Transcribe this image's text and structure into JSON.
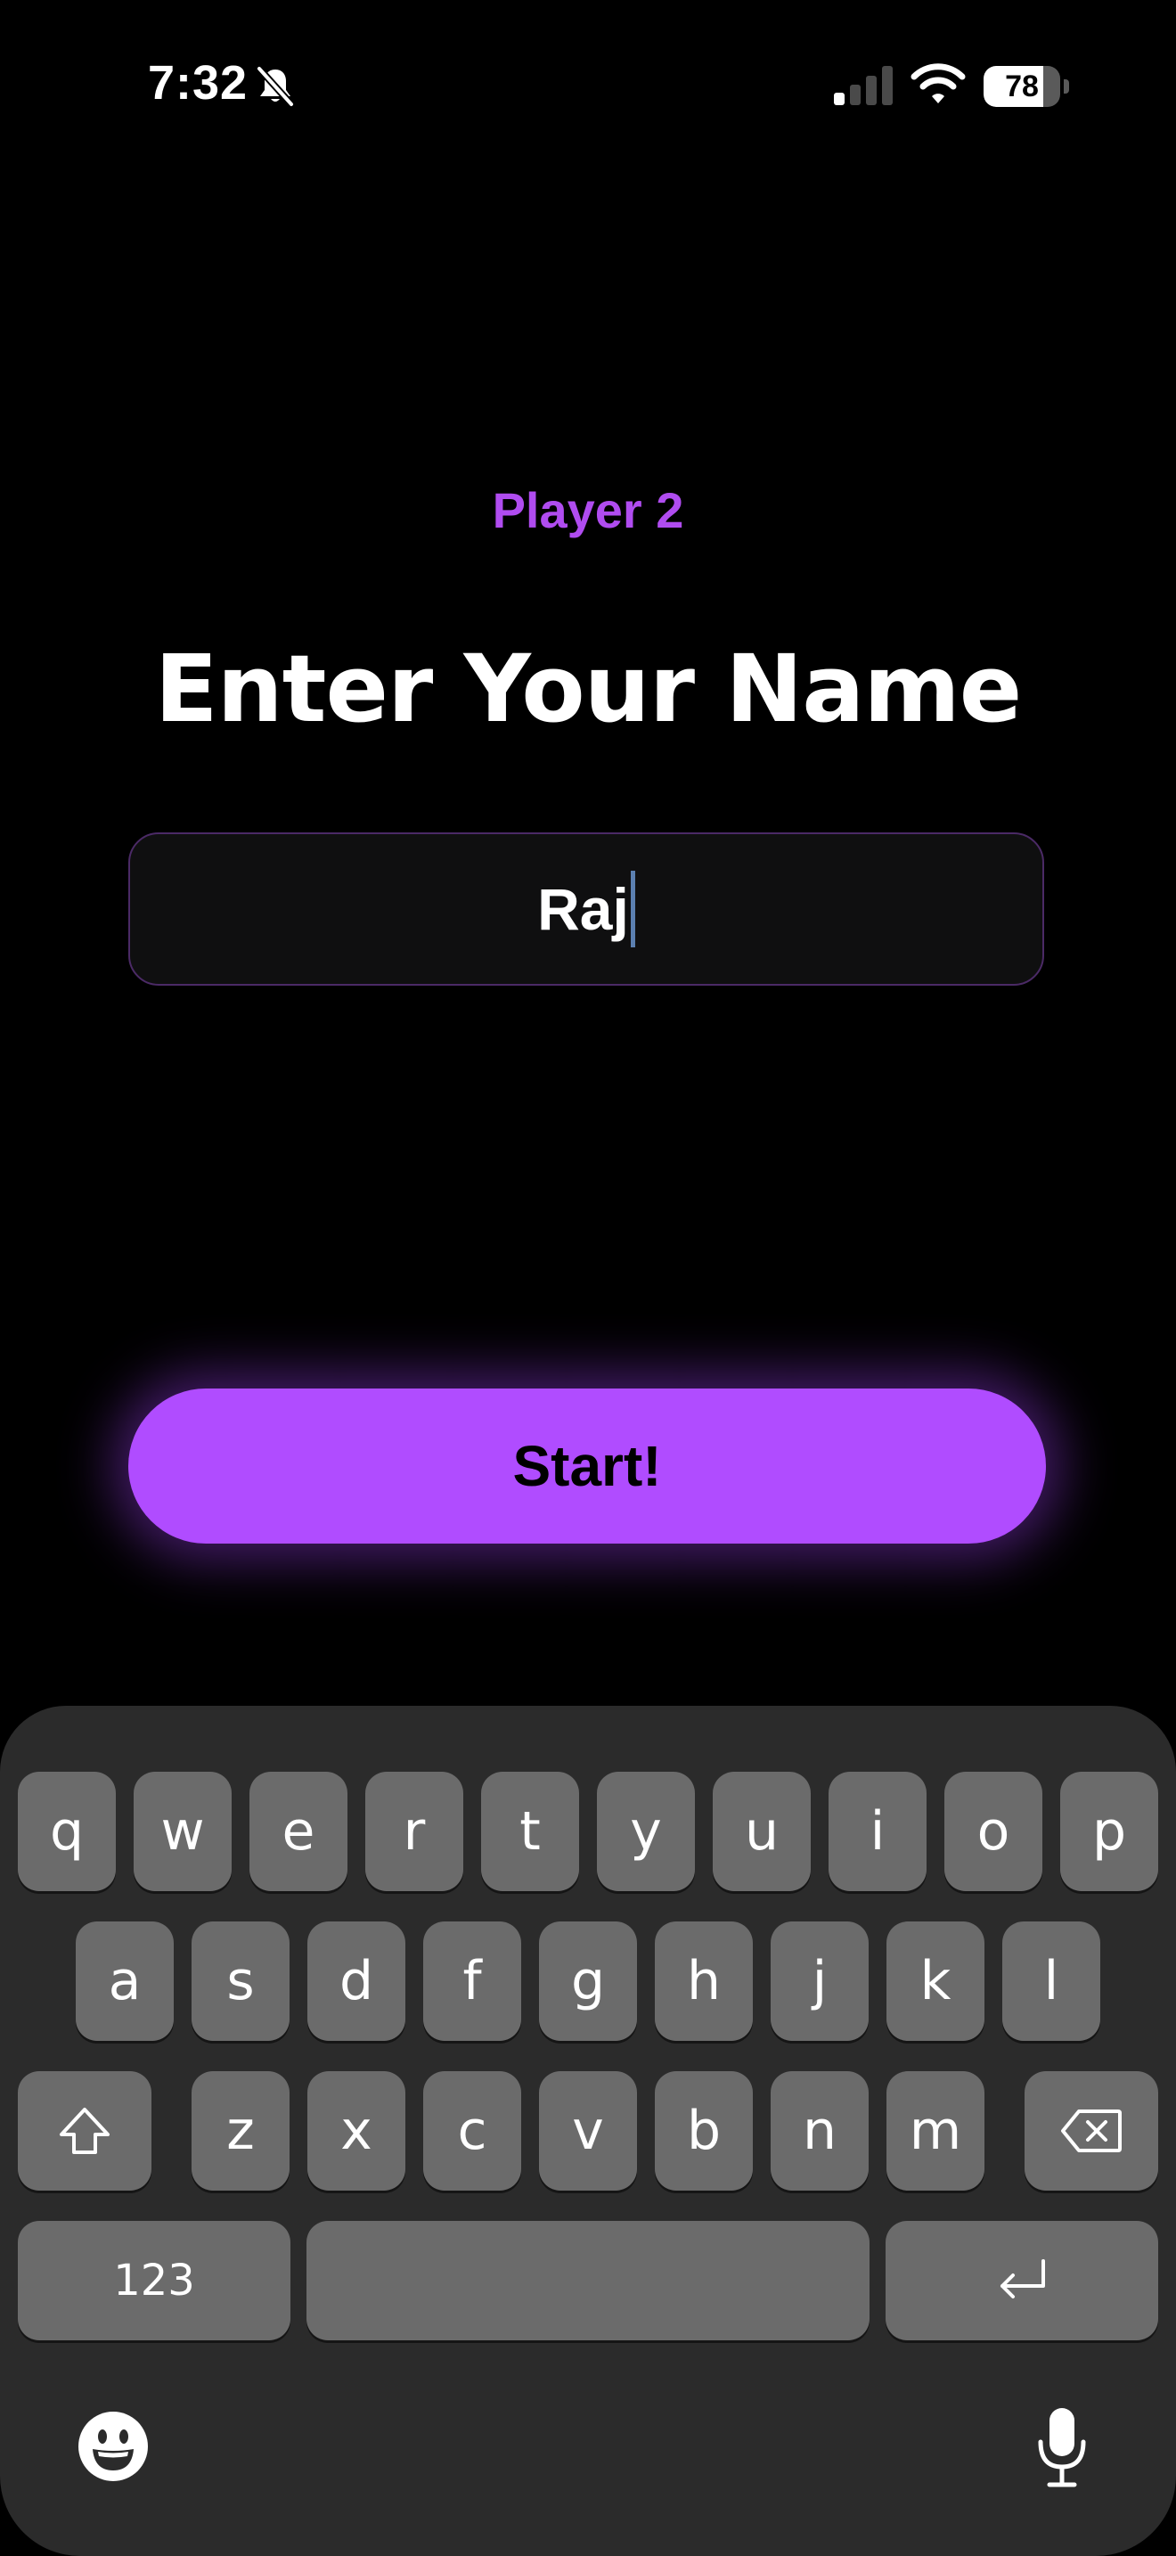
{
  "status_bar": {
    "time": "7:32",
    "battery_level": "78",
    "battery_fraction": 0.78,
    "icons": [
      "bell-slash-icon",
      "cellular-signal-icon",
      "wifi-icon",
      "battery-icon"
    ]
  },
  "header": {
    "player_label": "Player 2",
    "title": "Enter Your Name"
  },
  "name_input": {
    "value": "Raj"
  },
  "start_button": {
    "label": "Start!"
  },
  "colors": {
    "accent": "#b04cff",
    "accent_text": "#b04cf0",
    "background": "#000000",
    "keyboard_bg": "#2b2b2b",
    "key_bg": "#6b6b6b",
    "input_border": "#4b2a66",
    "cursor": "#5b7fb0"
  },
  "keyboard": {
    "rows": [
      [
        "q",
        "w",
        "e",
        "r",
        "t",
        "y",
        "u",
        "i",
        "o",
        "p"
      ],
      [
        "a",
        "s",
        "d",
        "f",
        "g",
        "h",
        "j",
        "k",
        "l"
      ],
      [
        "z",
        "x",
        "c",
        "v",
        "b",
        "n",
        "m"
      ]
    ],
    "numbers_key": "123",
    "icons": [
      "shift-icon",
      "backspace-icon",
      "return-icon",
      "emoji-icon",
      "microphone-icon"
    ]
  }
}
